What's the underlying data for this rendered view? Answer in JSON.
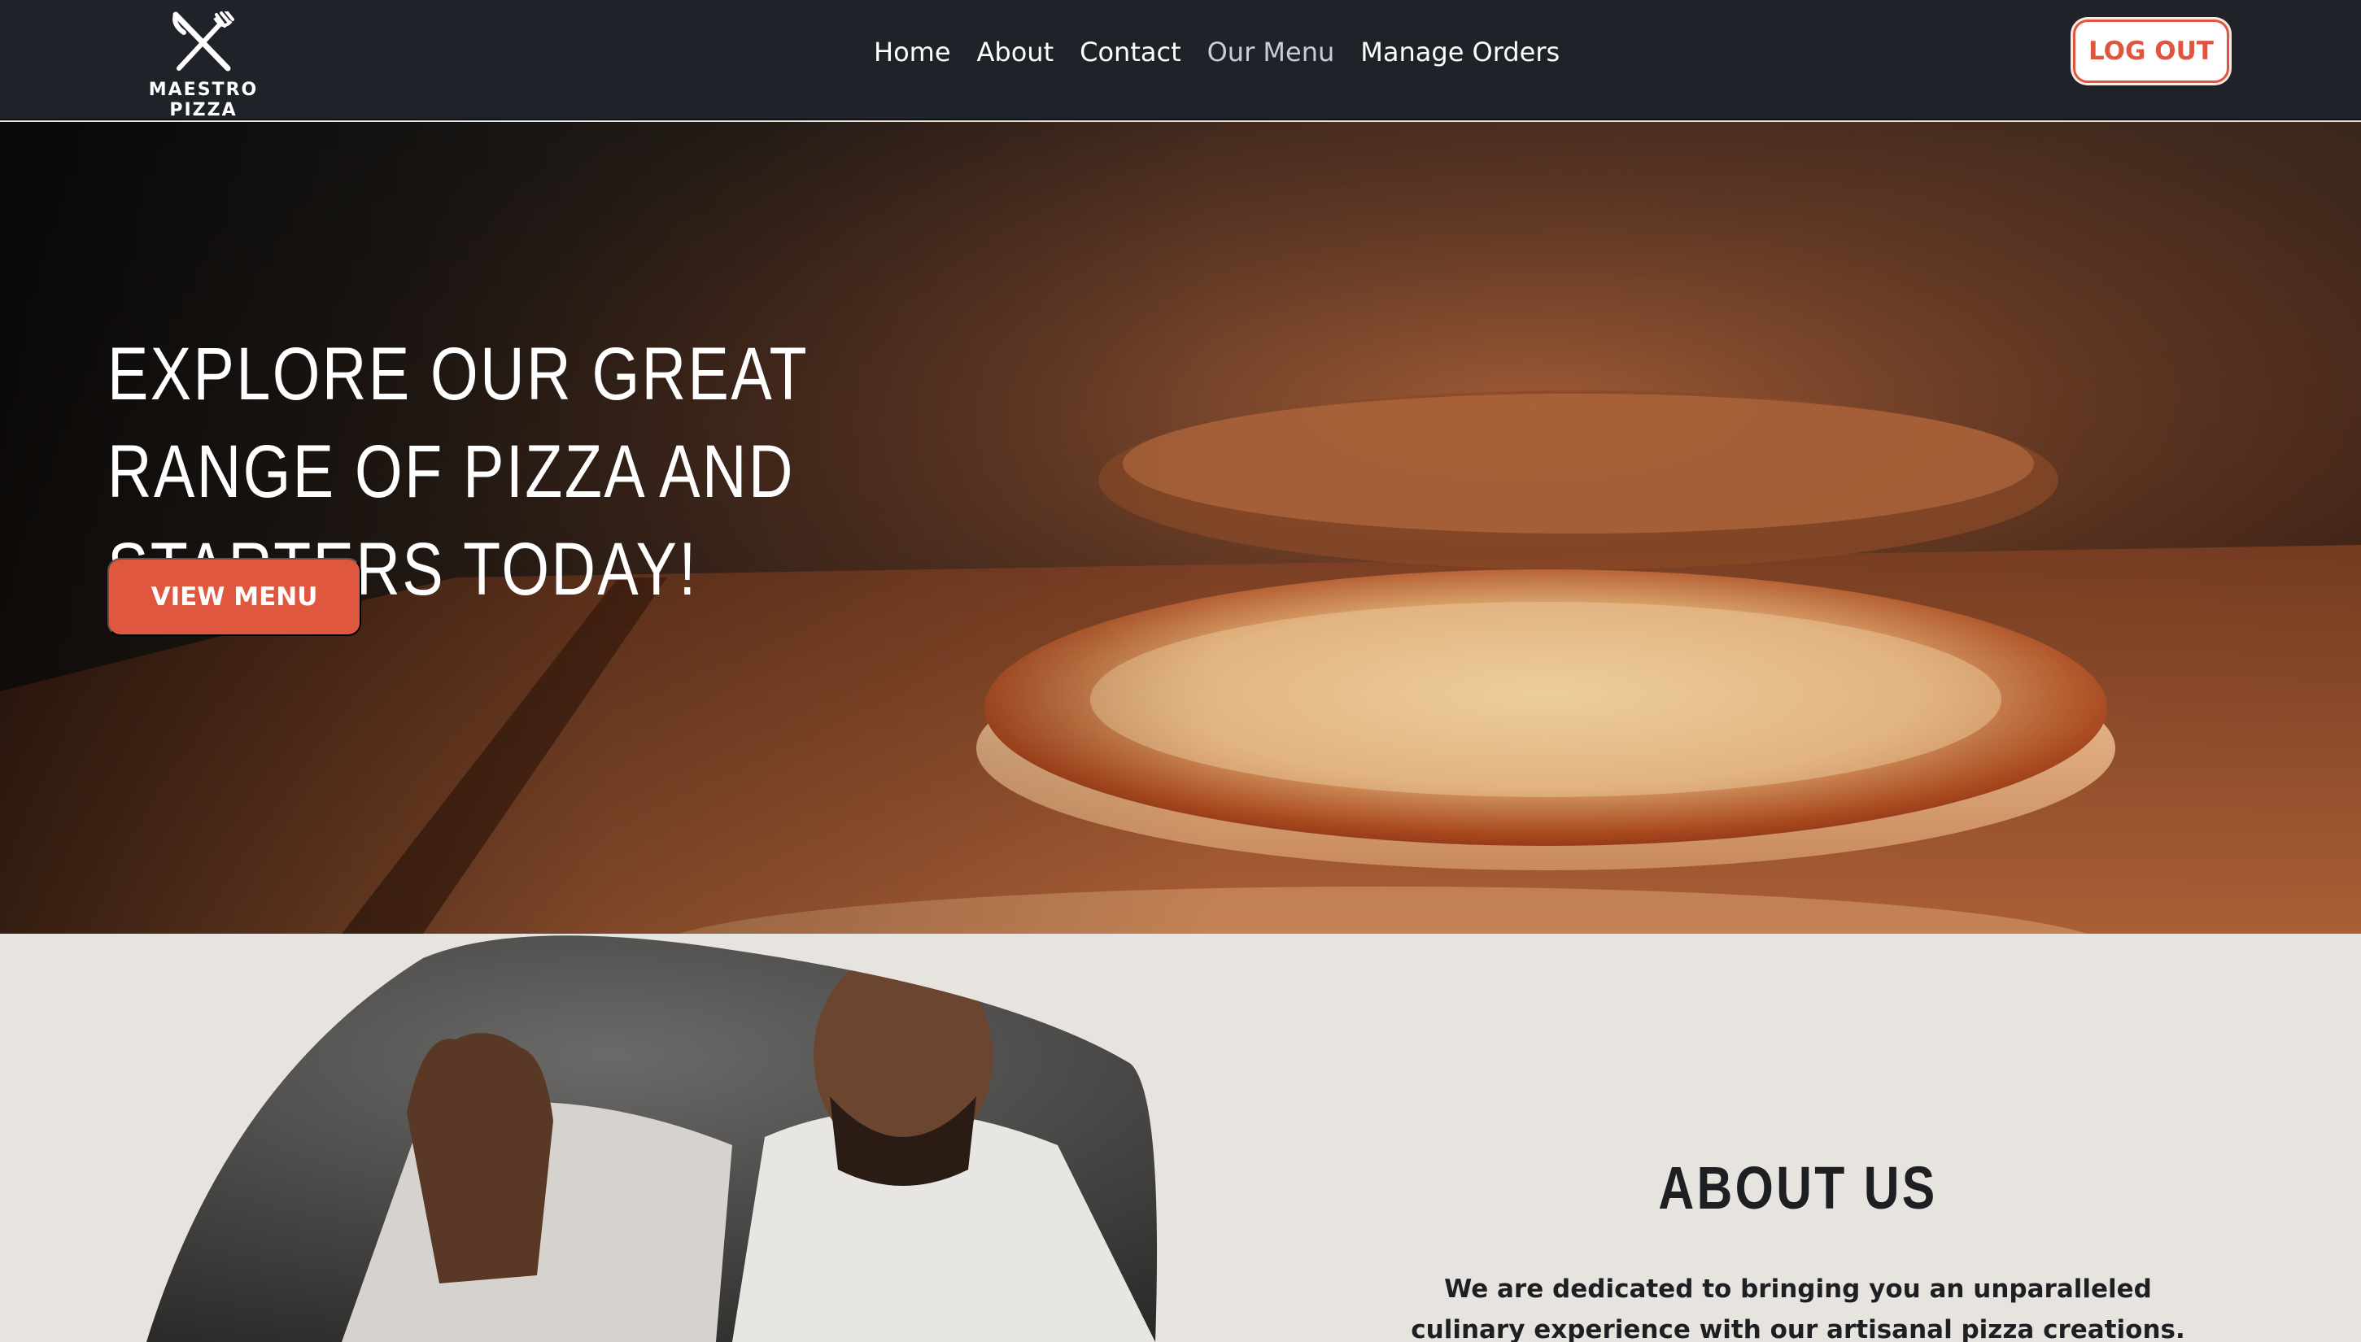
{
  "brand": {
    "name": "MAESTRO PIZZA"
  },
  "nav": {
    "items": [
      {
        "label": "Home",
        "active": false
      },
      {
        "label": "About",
        "active": false
      },
      {
        "label": "Contact",
        "active": false
      },
      {
        "label": "Our Menu",
        "active": true
      },
      {
        "label": "Manage Orders",
        "active": false
      }
    ],
    "logout_label": "LOG OUT"
  },
  "hero": {
    "title": "EXPLORE OUR GREAT RANGE OF PIZZA AND STARTERS TODAY!",
    "cta_label": "VIEW MENU"
  },
  "about": {
    "title": "ABOUT US",
    "text": "We are dedicated to bringing you an unparalleled culinary experience with our artisanal pizza creations."
  },
  "colors": {
    "navbar_bg": "#1f2329",
    "accent": "#e0573f",
    "section_bg": "#e7e4df",
    "active_nav": "#c9ccd1"
  },
  "icons": {
    "logo": "crossed-knife-fork-icon"
  }
}
